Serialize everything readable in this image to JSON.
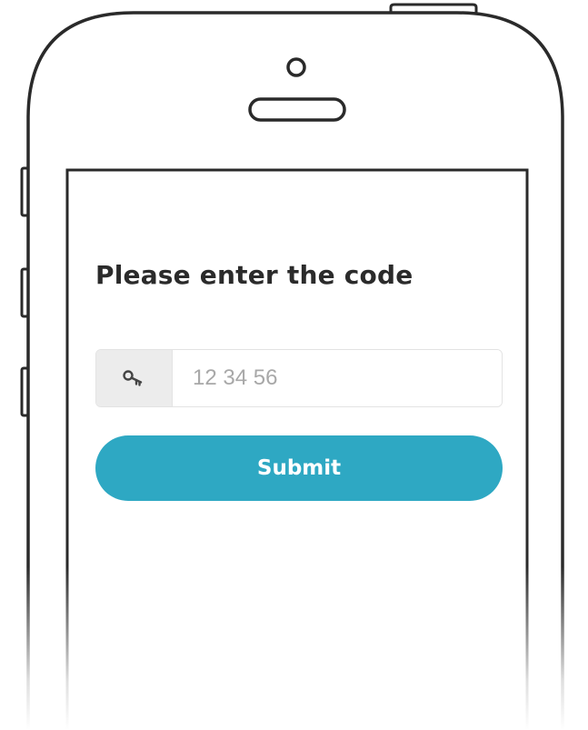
{
  "screen": {
    "title": "Please enter the code",
    "code_input": {
      "value": "",
      "placeholder": "12 34 56",
      "icon": "key-icon"
    },
    "submit_label": "Submit"
  },
  "colors": {
    "accent": "#2ea8c3",
    "addon_background": "#ececec",
    "outline": "#2a2a2a",
    "title_text": "#2b2b2b"
  }
}
